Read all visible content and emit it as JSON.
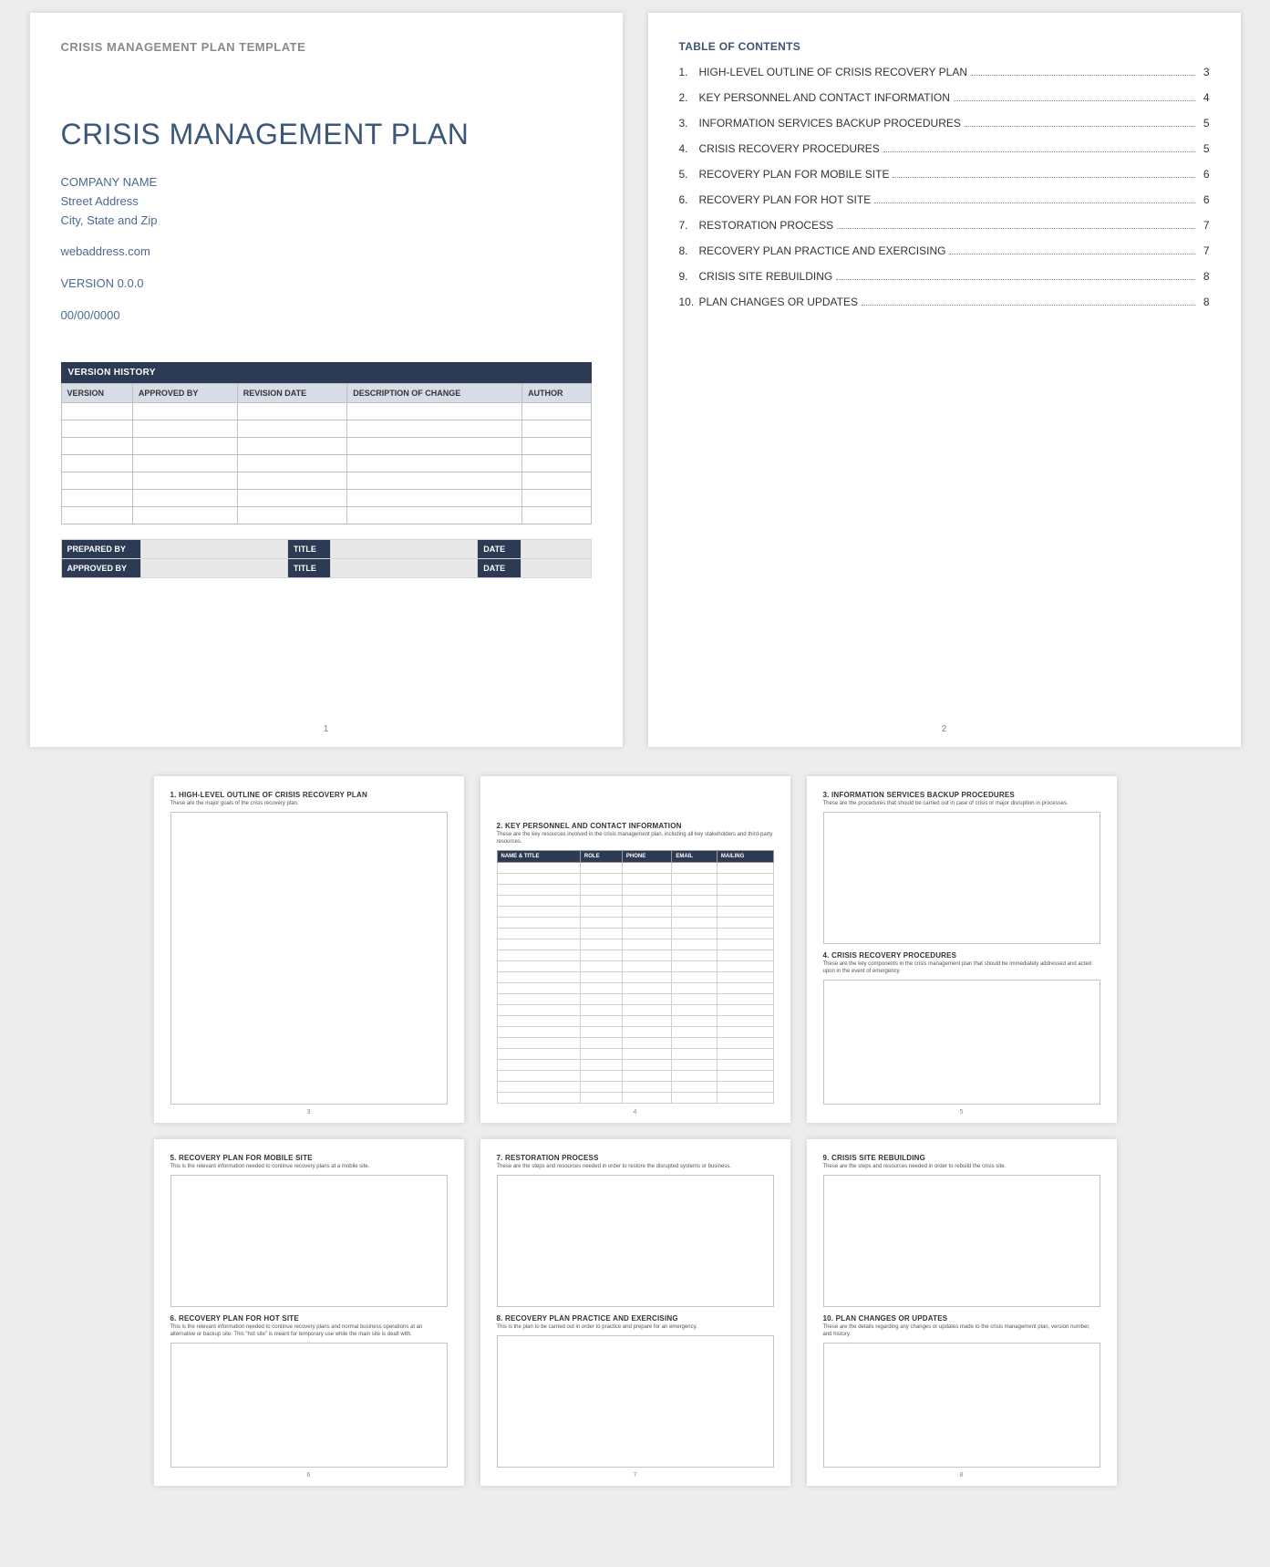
{
  "templateHeader": "CRISIS MANAGEMENT PLAN TEMPLATE",
  "mainTitle": "CRISIS MANAGEMENT PLAN",
  "company": {
    "name": "COMPANY NAME",
    "street": "Street Address",
    "cityStateZip": "City, State and Zip",
    "web": "webaddress.com",
    "version": "VERSION 0.0.0",
    "date": "00/00/0000"
  },
  "versionHistory": {
    "banner": "VERSION HISTORY",
    "headers": [
      "VERSION",
      "APPROVED BY",
      "REVISION DATE",
      "DESCRIPTION OF CHANGE",
      "AUTHOR"
    ],
    "rowCount": 7
  },
  "signoff": {
    "row1": [
      "PREPARED BY",
      "",
      "TITLE",
      "",
      "DATE",
      ""
    ],
    "row2": [
      "APPROVED BY",
      "",
      "TITLE",
      "",
      "DATE",
      ""
    ]
  },
  "toc": {
    "header": "TABLE OF CONTENTS",
    "items": [
      {
        "n": "1.",
        "t": "HIGH-LEVEL OUTLINE OF CRISIS RECOVERY PLAN",
        "p": "3"
      },
      {
        "n": "2.",
        "t": "KEY PERSONNEL AND CONTACT INFORMATION",
        "p": "4"
      },
      {
        "n": "3.",
        "t": "INFORMATION SERVICES BACKUP PROCEDURES",
        "p": "5"
      },
      {
        "n": "4.",
        "t": "CRISIS RECOVERY PROCEDURES",
        "p": "5"
      },
      {
        "n": "5.",
        "t": "RECOVERY PLAN FOR MOBILE SITE",
        "p": "6"
      },
      {
        "n": "6.",
        "t": "RECOVERY PLAN FOR HOT SITE",
        "p": "6"
      },
      {
        "n": "7.",
        "t": "RESTORATION PROCESS",
        "p": "7"
      },
      {
        "n": "8.",
        "t": "RECOVERY PLAN PRACTICE AND EXERCISING",
        "p": "7"
      },
      {
        "n": "9.",
        "t": "CRISIS SITE REBUILDING",
        "p": "8"
      },
      {
        "n": "10.",
        "t": "PLAN CHANGES OR UPDATES",
        "p": "8"
      }
    ]
  },
  "pages": {
    "p1": "1",
    "p2": "2",
    "p3": "3",
    "p4": "4",
    "p5": "5",
    "p6": "6",
    "p7": "7",
    "p8": "8"
  },
  "sections": {
    "s1": {
      "title": "1. HIGH-LEVEL OUTLINE OF CRISIS RECOVERY PLAN",
      "sub": "These are the major goals of the crisis recovery plan."
    },
    "s2": {
      "title": "2. KEY PERSONNEL AND CONTACT INFORMATION",
      "sub": "These are the key resources involved in the crisis management plan, including all key stakeholders and third-party resources."
    },
    "s3": {
      "title": "3. INFORMATION SERVICES BACKUP PROCEDURES",
      "sub": "These are the procedures that should be carried out in case of crisis or major disruption in processes."
    },
    "s4": {
      "title": "4. CRISIS RECOVERY PROCEDURES",
      "sub": "These are the key components in the crisis management plan that should be immediately addressed and acted upon in the event of emergency."
    },
    "s5": {
      "title": "5. RECOVERY PLAN FOR MOBILE SITE",
      "sub": "This is the relevant information needed to continue recovery plans at a mobile site."
    },
    "s6": {
      "title": "6. RECOVERY PLAN FOR HOT SITE",
      "sub": "This is the relevant information needed to continue recovery plans and normal business operations at an alternative or backup site. This \"hot site\" is meant for temporary use while the main site is dealt with."
    },
    "s7": {
      "title": "7. RESTORATION PROCESS",
      "sub": "These are the steps and resources needed in order to restore the disrupted systems or business."
    },
    "s8": {
      "title": "8. RECOVERY PLAN PRACTICE AND EXERCISING",
      "sub": "This is the plan to be carried out in order to practice and prepare for an emergency."
    },
    "s9": {
      "title": "9. CRISIS SITE REBUILDING",
      "sub": "These are the steps and resources needed in order to rebuild the crisis site."
    },
    "s10": {
      "title": "10.   PLAN CHANGES OR UPDATES",
      "sub": "These are the details regarding any changes or updates made to the crisis management plan, version number, and history."
    }
  },
  "contactHeaders": [
    "NAME & TITLE",
    "ROLE",
    "PHONE",
    "EMAIL",
    "MAILING"
  ],
  "contactRowCount": 22
}
